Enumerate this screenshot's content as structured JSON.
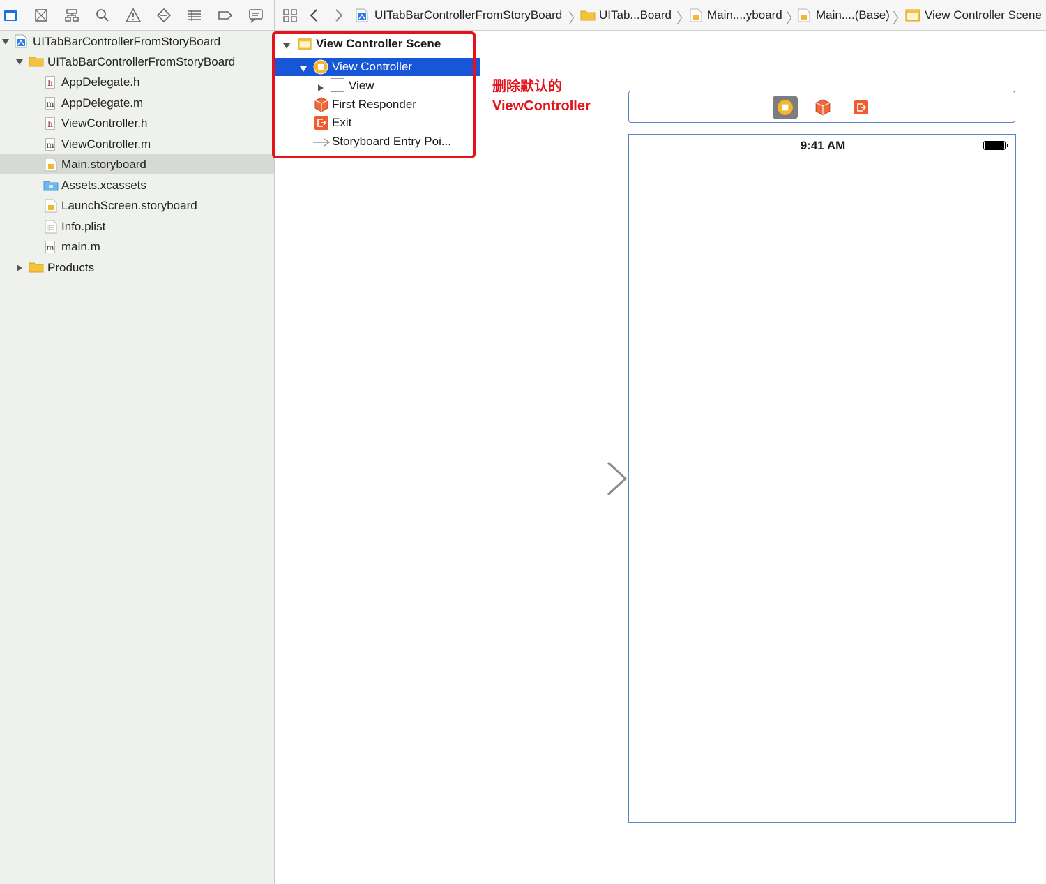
{
  "navigator": {
    "toolbar_icons": [
      "folder-icon",
      "source-control-icon",
      "hierarchy-icon",
      "search-icon",
      "warning-icon",
      "test-icon",
      "debug-icon",
      "breakpoint-icon",
      "report-icon"
    ],
    "items": [
      {
        "label": "UITabBarControllerFromStoryBoard",
        "icon": "project-icon",
        "expanded": true
      },
      {
        "label": "UITabBarControllerFromStoryBoard",
        "icon": "folder-icon",
        "expanded": true
      },
      {
        "label": "AppDelegate.h",
        "icon": "header-file-icon",
        "glyph": "h"
      },
      {
        "label": "AppDelegate.m",
        "icon": "source-file-icon",
        "glyph": "m"
      },
      {
        "label": "ViewController.h",
        "icon": "header-file-icon",
        "glyph": "h"
      },
      {
        "label": "ViewController.m",
        "icon": "source-file-icon",
        "glyph": "m"
      },
      {
        "label": "Main.storyboard",
        "icon": "storyboard-file-icon",
        "selected": true
      },
      {
        "label": "Assets.xcassets",
        "icon": "assets-folder-icon"
      },
      {
        "label": "LaunchScreen.storyboard",
        "icon": "storyboard-file-icon"
      },
      {
        "label": "Info.plist",
        "icon": "plist-file-icon"
      },
      {
        "label": "main.m",
        "icon": "source-file-icon",
        "glyph": "m"
      },
      {
        "label": "Products",
        "icon": "folder-icon",
        "expanded": false
      }
    ]
  },
  "breadcrumbs": [
    "UITabBarControllerFromStoryBoard",
    "UITab...Board",
    "Main....yboard",
    "Main....(Base)",
    "View Controller Scene"
  ],
  "outline": {
    "scene": "View Controller Scene",
    "items": [
      {
        "label": "View Controller",
        "selected": true
      },
      {
        "label": "View"
      },
      {
        "label": "First Responder"
      },
      {
        "label": "Exit"
      },
      {
        "label": "Storyboard Entry Poi..."
      }
    ]
  },
  "annotation": {
    "line1": "删除默认的",
    "line2": "ViewController",
    "color": "#e3121b"
  },
  "device": {
    "status_time": "9:41 AM"
  },
  "colors": {
    "selection_blue": "#1756d6",
    "highlight_red": "#e3121b",
    "frame_blue": "#5b86c9"
  }
}
